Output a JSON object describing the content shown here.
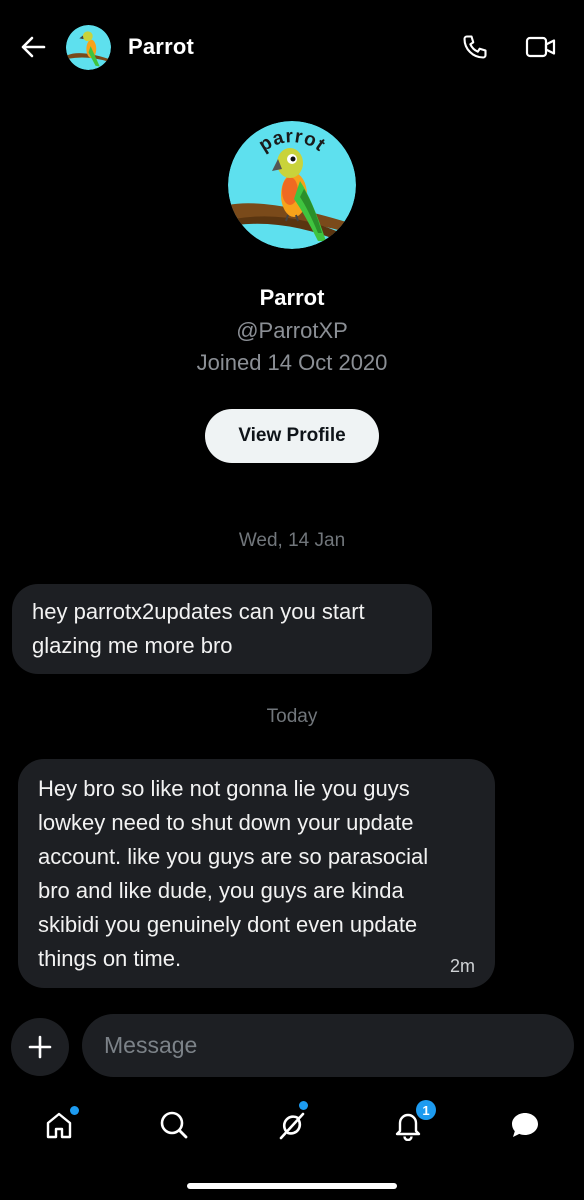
{
  "header": {
    "name": "Parrot"
  },
  "profile": {
    "avatar_text": "parrot",
    "name": "Parrot",
    "handle": "@ParrotXP",
    "joined": "Joined 14  Oct 2020",
    "view_profile_label": "View Profile"
  },
  "conversation": {
    "date_1": "Wed, 14 Jan",
    "message_1_lines": [
      "hey parrotx2updates can you start",
      "glazing me more bro"
    ],
    "date_2": "Today",
    "message_2_lines": [
      "Hey bro so like not gonna lie you guys",
      "lowkey need to shut down your update",
      "account. like you guys are so parasocial",
      "bro and like dude, you guys are kinda",
      "skibidi you genuinely dont even update",
      "things on time."
    ],
    "message_2_time": "2m"
  },
  "composer": {
    "placeholder": "Message",
    "value": ""
  },
  "nav": {
    "items": [
      "home-icon",
      "search-icon",
      "grok-icon",
      "notifications-icon",
      "messages-icon"
    ],
    "notifications_badge": "1",
    "accent": "#1d9bf0"
  }
}
